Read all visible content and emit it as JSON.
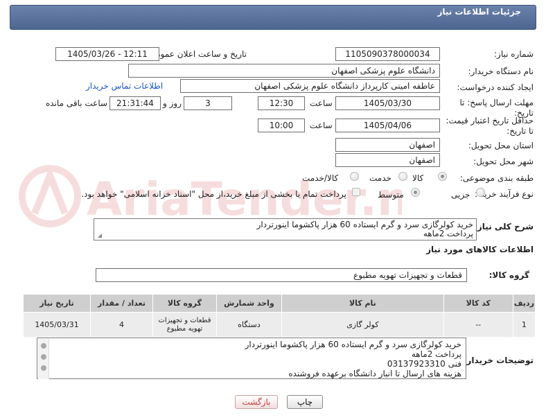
{
  "header": {
    "title": "جزئیات اطلاعات نیاز"
  },
  "fields": {
    "need_number_label": "شماره نیاز:",
    "need_number": "1105090378000034",
    "announce_label": "تاریخ و ساعت اعلان عمومی:",
    "announce_value": "1405/03/26 - 12:11",
    "buyer_org_label": "نام دستگاه خریدار:",
    "buyer_org": "دانشگاه علوم پزشکی اصفهان",
    "requester_label": "ایجاد کننده درخواست:",
    "requester": "عاطفه امینی کارپرداز دانشگاه علوم پزشکی اصفهان",
    "contact_link": "اطلاعات تماس خریدار",
    "deadline_label": "مهلت ارسال پاسخ: تا تاریخ:",
    "deadline_date": "1405/03/30",
    "time_label": "ساعت",
    "deadline_time": "12:30",
    "days_value": "3",
    "days_label": "روز و",
    "remaining_value": "21:31:44",
    "remaining_label": "ساعت باقی مانده",
    "price_validity_label": "حداقل تاریخ اعتبار قیمت: تا تاریخ:",
    "price_date": "1405/04/06",
    "price_time_label": "ساعت",
    "price_time": "10:00",
    "province_label": "استان محل تحویل:",
    "province": "اصفهان",
    "city_label": "شهر محل تحویل:",
    "city": "اصفهان",
    "category_label": "طبقه بندی موضوعی:",
    "category_options": [
      "کالا",
      "خدمت",
      "کالا/خدمت"
    ],
    "purchase_type_label": "نوع فرآیند خرید :",
    "purchase_options": [
      "جزیی",
      "متوسط"
    ],
    "payment_note": "پرداخت تمام یا بخشی از مبلغ خرید،از محل \"اسناد خزانه اسلامی\" خواهد بود."
  },
  "description": {
    "label": "شرح کلی نیاز:",
    "lines": [
      "خرید کولرگازی سرد و گرم ایستاده 60 هزار پاکشوما اینورتردار",
      "پرداخت 2ماهه"
    ]
  },
  "goods_section": {
    "title": "اطلاعات کالاهای مورد نیاز"
  },
  "goods_group": {
    "label": "گروه کالا:",
    "value": "قطعات و تجهیزات تهویه مطبوع"
  },
  "table": {
    "headers": [
      "ردیف",
      "کد کالا",
      "نام کالا",
      "واحد شمارش",
      "گروه کالا",
      "تعداد / مقدار",
      "تاریخ نیاز"
    ],
    "rows": [
      [
        "1",
        "--",
        "کولر گازی",
        "دستگاه",
        "قطعات و تجهیزات تهویه مطبوع",
        "4",
        "1405/03/31"
      ]
    ]
  },
  "buyer_notes": {
    "label": "توضیحات خریدار:",
    "lines": [
      "خرید کولرگازی سرد و گرم ایستاده 60 هزار پاکشوما اینورتردار",
      "پرداخت 2ماهه",
      "فنی 03137923310",
      "هزینه های ارسال تا انبار دانشگاه برعهده فروشنده"
    ]
  },
  "buttons": {
    "print": "چاپ",
    "back": "بازگشت"
  },
  "watermark": {
    "text": "AriaTender.neT"
  },
  "colors": {
    "header": "#5a73a0",
    "link": "#1a55c8",
    "back_text": "#c23d3d"
  }
}
